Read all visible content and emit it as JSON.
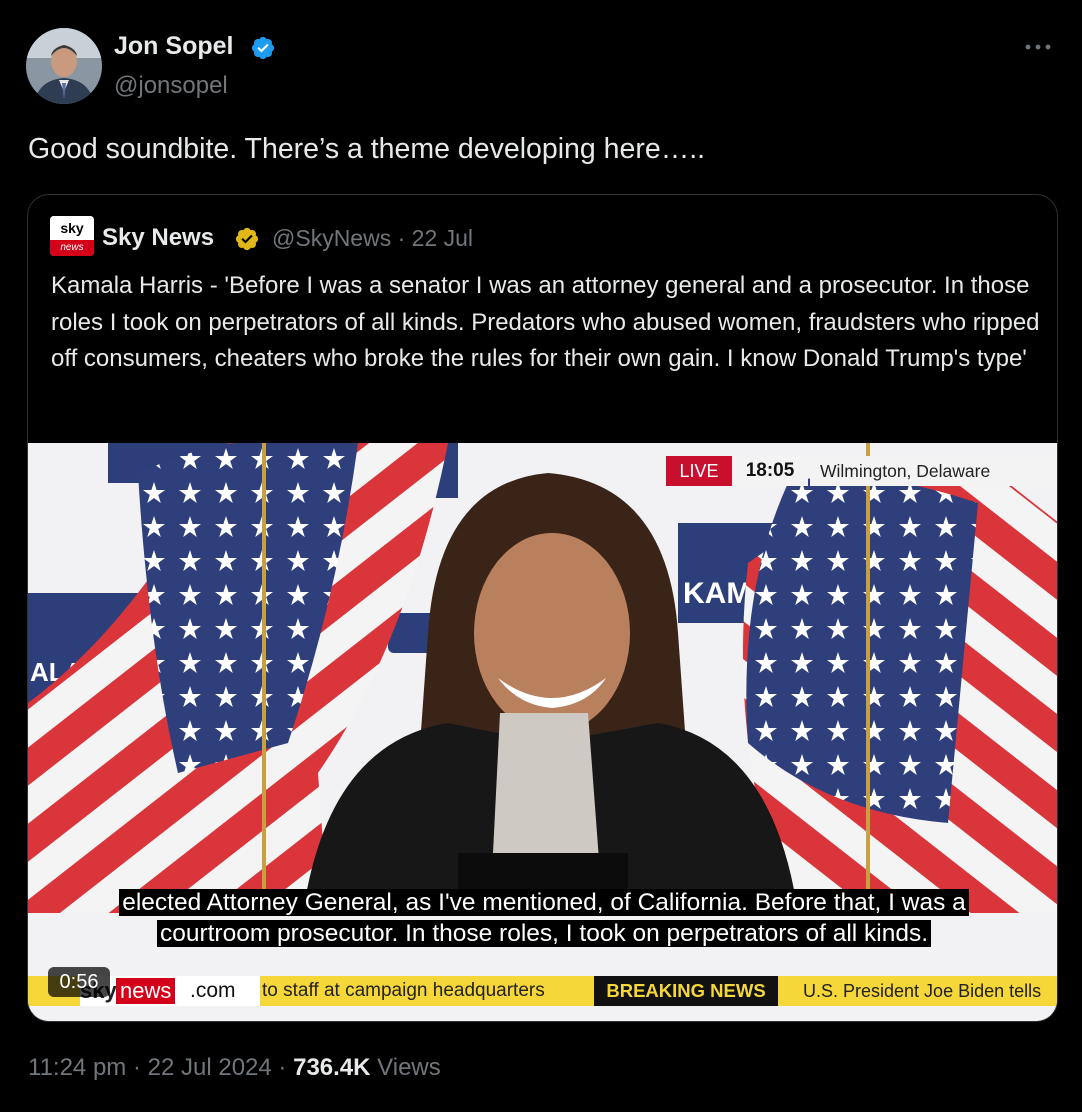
{
  "author": {
    "name": "Jon Sopel",
    "handle": "@jonsopel"
  },
  "tweet": {
    "text": "Good soundbite. There’s a theme developing here….."
  },
  "quoted_tweet": {
    "logo_top": "sky",
    "logo_bottom": "news",
    "name": "Sky News",
    "handle": "@SkyNews",
    "separator": "·",
    "date": "22 Jul",
    "text": "Kamala Harris - 'Before I was a senator I was an attorney general and a prosecutor. In those roles I took on perpetrators of all kinds. Predators who abused women, fraudsters who ripped off consumers, cheaters who broke the rules for their own gain. I know Donald Trump's type'"
  },
  "video": {
    "live_label": "LIVE",
    "time": "18:05",
    "location": "Wilmington, Delaware",
    "sign_text": "KAM",
    "sign_text_left": "ALA",
    "caption_line1": "elected Attorney General, as I've mentioned, of California. Before that, I was a",
    "caption_line2": "courtroom prosecutor. In those roles, I took on perpetrators of all kinds.",
    "brand_sky": "sky",
    "brand_news": "news",
    "brand_com": ".com",
    "ticker_item1": "to staff at campaign headquarters",
    "ticker_breaking": "BREAKING NEWS",
    "ticker_item2": "U.S. President Joe Biden tells",
    "duration": "0:56"
  },
  "footer": {
    "time": "11:24 pm",
    "date": "22 Jul 2024",
    "sep": "·",
    "views_count": "736.4K",
    "views_label": "Views"
  },
  "colors": {
    "background": "#000000",
    "text_primary": "#e7e9ea",
    "text_secondary": "#71767b",
    "border": "#2f3336",
    "verified_blue": "#1d9bf0",
    "verified_gold": "#e2b719",
    "sky_red": "#c8102e",
    "ticker_yellow": "#f6d73a"
  }
}
